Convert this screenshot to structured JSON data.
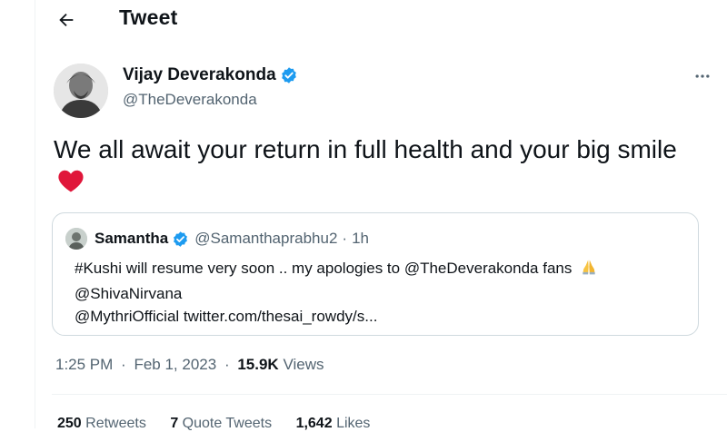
{
  "header": {
    "title": "Tweet",
    "back_icon": "arrow-left-icon"
  },
  "author": {
    "name": "Vijay Deverakonda",
    "handle": "@TheDeverakonda",
    "verified_color": "#1d9bf0"
  },
  "tweet": {
    "text": "We all await your return in full health and your big smile",
    "emoji_icon": "red-heart-icon"
  },
  "quoted": {
    "name": "Samantha",
    "handle": "@Samanthaprabhu2",
    "separator": "·",
    "time": "1h",
    "lines": [
      "#Kushi will resume very soon .. my apologies to @TheDeverakonda fans",
      "@ShivaNirvana",
      "@MythriOfficial twitter.com/thesai_rowdy/s..."
    ],
    "emoji_icon": "folded-hands-icon"
  },
  "meta": {
    "time": "1:25 PM",
    "dot": "·",
    "date": "Feb 1, 2023",
    "views_count": "15.9K",
    "views_label": "Views"
  },
  "stats": {
    "retweets_count": "250",
    "retweets_label": "Retweets",
    "quotes_count": "7",
    "quotes_label": "Quote Tweets",
    "likes_count": "1,642",
    "likes_label": "Likes"
  },
  "colors": {
    "accent": "#1d9bf0",
    "heart": "#f91880",
    "muted": "#536471"
  }
}
